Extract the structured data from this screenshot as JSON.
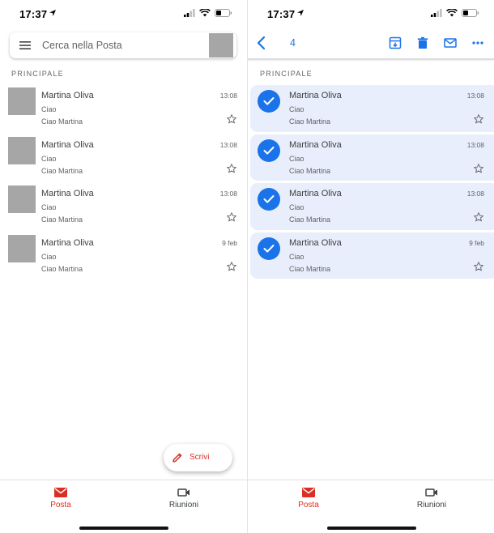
{
  "status": {
    "time": "17:37"
  },
  "inbox": {
    "search_placeholder": "Cerca nella Posta",
    "section_label": "PRINCIPALE",
    "emails": [
      {
        "sender": "Martina Oliva",
        "subject": "Ciao",
        "preview": "Ciao Martina",
        "date": "13:08"
      },
      {
        "sender": "Martina Oliva",
        "subject": "Ciao",
        "preview": "Ciao Martina",
        "date": "13:08"
      },
      {
        "sender": "Martina Oliva",
        "subject": "Ciao",
        "preview": "Ciao Martina",
        "date": "13:08"
      },
      {
        "sender": "Martina Oliva",
        "subject": "Ciao",
        "preview": "Ciao Martina",
        "date": "9 feb"
      }
    ],
    "compose_label": "Scrivi"
  },
  "selection": {
    "selected_count": "4",
    "actions": [
      "back-icon",
      "archive-icon",
      "trash-icon",
      "mark-unread-icon",
      "more-icon"
    ],
    "section_label": "PRINCIPALE",
    "emails": [
      {
        "sender": "Martina Oliva",
        "subject": "Ciao",
        "preview": "Ciao Martina",
        "date": "13:08",
        "selected": true
      },
      {
        "sender": "Martina Oliva",
        "subject": "Ciao",
        "preview": "Ciao Martina",
        "date": "13:08",
        "selected": true
      },
      {
        "sender": "Martina Oliva",
        "subject": "Ciao",
        "preview": "Ciao Martina",
        "date": "13:08",
        "selected": true
      },
      {
        "sender": "Martina Oliva",
        "subject": "Ciao",
        "preview": "Ciao Martina",
        "date": "9 feb",
        "selected": true
      }
    ]
  },
  "tabs": [
    {
      "label": "Posta",
      "icon": "mail-icon",
      "active": true
    },
    {
      "label": "Riunioni",
      "icon": "video-icon",
      "active": false
    }
  ],
  "colors": {
    "accent_blue": "#1a73e8",
    "accent_red": "#d93025",
    "selected_bg": "#e8eefb",
    "placeholder_gray": "#a6a6a6"
  }
}
